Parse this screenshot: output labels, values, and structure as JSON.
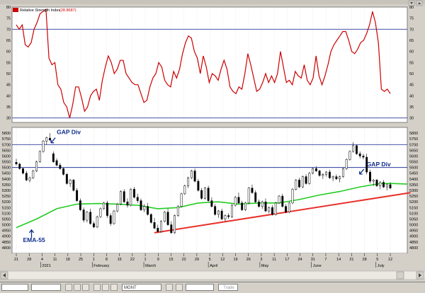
{
  "window": {
    "indicator_title": "Relative Strength Index",
    "indicator_value": "(28.8687)",
    "accent_color": "#cc0000"
  },
  "statusbar": {
    "symbol_field": "MGNT",
    "trade_label": "Trade"
  },
  "chart_data": [
    {
      "type": "line",
      "name": "Relative Strength Index",
      "ylim": [
        28,
        80
      ],
      "y_ticks": [
        30,
        35,
        40,
        45,
        50,
        55,
        60,
        65,
        70,
        75,
        80
      ],
      "reference_lines": [
        70,
        30
      ],
      "line_color": "#cc0000",
      "reference_color": "#2b3a9e",
      "x": [
        0,
        1,
        2,
        3,
        4,
        5,
        6,
        7,
        8,
        9,
        10,
        11,
        12,
        13,
        14,
        15,
        16,
        17,
        18,
        19,
        20,
        21,
        22,
        23,
        24,
        25,
        26,
        27,
        28,
        29,
        30,
        31,
        32,
        33,
        34,
        35,
        36,
        37,
        38,
        39,
        40,
        41,
        42,
        43,
        44,
        45,
        46,
        47,
        48,
        49,
        50,
        51,
        52,
        53,
        54,
        55,
        56,
        57,
        58,
        59,
        60,
        61,
        62,
        63,
        64,
        65,
        66,
        67,
        68,
        69,
        70,
        71,
        72,
        73,
        74,
        75,
        76,
        77,
        78,
        79,
        80,
        81,
        82,
        83,
        84,
        85,
        86,
        87,
        88,
        89,
        90,
        91,
        92,
        93,
        94,
        95,
        96,
        97,
        98,
        99,
        100,
        101,
        102,
        103,
        104,
        105,
        106,
        107,
        108,
        109,
        110,
        111,
        112,
        113,
        114,
        115,
        116,
        117,
        118,
        119,
        120,
        121,
        122,
        123,
        124,
        125,
        126
      ],
      "values": [
        72,
        70,
        72,
        63,
        62,
        64,
        70,
        73,
        77,
        78,
        79,
        57,
        54,
        55,
        45,
        43,
        37,
        35,
        30,
        36,
        44,
        44,
        39,
        33,
        35,
        40,
        42,
        43,
        38,
        47,
        53,
        58,
        55,
        50,
        52,
        56,
        56,
        50,
        48,
        46,
        45,
        45,
        41,
        37,
        38,
        44,
        48,
        50,
        55,
        53,
        47,
        45,
        44,
        51,
        48,
        52,
        59,
        64,
        67,
        66,
        60,
        57,
        50,
        58,
        53,
        46,
        50,
        49,
        47,
        52,
        56,
        52,
        44,
        42,
        41,
        44,
        43,
        50,
        59,
        54,
        48,
        42,
        43,
        46,
        50,
        46,
        49,
        46,
        50,
        60,
        53,
        46,
        47,
        45,
        51,
        49,
        48,
        54,
        47,
        45,
        48,
        58,
        49,
        45,
        49,
        54,
        60,
        63,
        65,
        67,
        69,
        69,
        65,
        60,
        59,
        61,
        64,
        65,
        68,
        72,
        78,
        73,
        64,
        43,
        42,
        43,
        41
      ],
      "x_categories": [
        "21",
        "28",
        "4",
        "11",
        "18",
        "25",
        "1",
        "8",
        "15",
        "22",
        "1",
        "9",
        "15",
        "22",
        "29",
        "5",
        "12",
        "19",
        "26",
        "3",
        "11",
        "17",
        "24",
        "31",
        "7",
        "14",
        "21",
        "28",
        "5",
        "12"
      ]
    },
    {
      "type": "candlestick",
      "ylim": [
        4750,
        5850
      ],
      "y_ticks": [
        4800,
        4850,
        4900,
        4950,
        5000,
        5050,
        5100,
        5150,
        5200,
        5250,
        5300,
        5350,
        5400,
        5450,
        5500,
        5550,
        5600,
        5650,
        5700,
        5750,
        5800
      ],
      "reference_lines": [
        5700,
        5500
      ],
      "month_labels": [
        "2021",
        "February",
        "March",
        "April",
        "May",
        "June",
        "July"
      ],
      "x_categories": [
        "21",
        "28",
        "4",
        "11",
        "18",
        "25",
        "1",
        "8",
        "15",
        "22",
        "1",
        "9",
        "15",
        "22",
        "29",
        "5",
        "12",
        "19",
        "26",
        "3",
        "11",
        "17",
        "24",
        "31",
        "7",
        "14",
        "21",
        "28",
        "5",
        "12"
      ],
      "ohlc": [
        [
          5545,
          5575,
          5520,
          5530
        ],
        [
          5530,
          5540,
          5480,
          5490
        ],
        [
          5490,
          5500,
          5440,
          5450
        ],
        [
          5450,
          5470,
          5380,
          5390
        ],
        [
          5390,
          5420,
          5370,
          5410
        ],
        [
          5410,
          5480,
          5400,
          5470
        ],
        [
          5470,
          5560,
          5460,
          5550
        ],
        [
          5550,
          5650,
          5540,
          5640
        ],
        [
          5640,
          5740,
          5630,
          5730
        ],
        [
          5730,
          5770,
          5700,
          5760
        ],
        [
          5755,
          5800,
          5730,
          5740
        ],
        [
          5620,
          5640,
          5540,
          5550
        ],
        [
          5560,
          5580,
          5510,
          5520
        ],
        [
          5520,
          5540,
          5480,
          5490
        ],
        [
          5490,
          5500,
          5430,
          5440
        ],
        [
          5440,
          5450,
          5350,
          5360
        ],
        [
          5360,
          5400,
          5330,
          5390
        ],
        [
          5390,
          5400,
          5290,
          5300
        ],
        [
          5300,
          5320,
          5200,
          5210
        ],
        [
          5210,
          5230,
          5120,
          5130
        ],
        [
          5130,
          5150,
          5020,
          5040
        ],
        [
          5040,
          5120,
          5020,
          5110
        ],
        [
          5110,
          5140,
          5000,
          5010
        ],
        [
          5010,
          5030,
          4970,
          4980
        ],
        [
          4980,
          5080,
          4970,
          5070
        ],
        [
          5070,
          5150,
          5060,
          5140
        ],
        [
          5140,
          5200,
          5130,
          5190
        ],
        [
          5190,
          5210,
          5060,
          5080
        ],
        [
          5080,
          5100,
          4990,
          5010
        ],
        [
          5010,
          5130,
          5000,
          5120
        ],
        [
          5120,
          5190,
          5110,
          5180
        ],
        [
          5180,
          5300,
          5170,
          5290
        ],
        [
          5290,
          5310,
          5190,
          5200
        ],
        [
          5200,
          5230,
          5150,
          5170
        ],
        [
          5170,
          5320,
          5160,
          5310
        ],
        [
          5310,
          5330,
          5230,
          5240
        ],
        [
          5240,
          5270,
          5190,
          5210
        ],
        [
          5210,
          5230,
          5120,
          5130
        ],
        [
          5130,
          5180,
          5110,
          5160
        ],
        [
          5160,
          5190,
          5080,
          5090
        ],
        [
          5090,
          5100,
          5010,
          5020
        ],
        [
          5020,
          5060,
          4960,
          4970
        ],
        [
          4970,
          5000,
          4930,
          4940
        ],
        [
          4940,
          5040,
          4930,
          5030
        ],
        [
          5030,
          5120,
          5020,
          5110
        ],
        [
          5110,
          5140,
          4990,
          5000
        ],
        [
          5000,
          5030,
          4920,
          4930
        ],
        [
          4930,
          5090,
          4920,
          5080
        ],
        [
          5080,
          5170,
          5070,
          5160
        ],
        [
          5160,
          5280,
          5150,
          5270
        ],
        [
          5270,
          5350,
          5260,
          5340
        ],
        [
          5340,
          5420,
          5320,
          5410
        ],
        [
          5410,
          5480,
          5400,
          5470
        ],
        [
          5470,
          5490,
          5370,
          5380
        ],
        [
          5380,
          5400,
          5290,
          5300
        ],
        [
          5300,
          5320,
          5220,
          5230
        ],
        [
          5230,
          5330,
          5220,
          5320
        ],
        [
          5320,
          5340,
          5200,
          5210
        ],
        [
          5210,
          5240,
          5150,
          5160
        ],
        [
          5160,
          5180,
          5080,
          5090
        ],
        [
          5090,
          5130,
          5060,
          5120
        ],
        [
          5120,
          5140,
          5040,
          5050
        ],
        [
          5050,
          5090,
          5030,
          5080
        ],
        [
          5080,
          5100,
          5050,
          5070
        ],
        [
          5070,
          5180,
          5060,
          5170
        ],
        [
          5170,
          5250,
          5160,
          5240
        ],
        [
          5240,
          5280,
          5180,
          5190
        ],
        [
          5190,
          5210,
          5120,
          5130
        ],
        [
          5130,
          5200,
          5120,
          5190
        ],
        [
          5190,
          5330,
          5180,
          5320
        ],
        [
          5320,
          5350,
          5270,
          5280
        ],
        [
          5280,
          5300,
          5190,
          5200
        ],
        [
          5200,
          5220,
          5150,
          5160
        ],
        [
          5160,
          5210,
          5140,
          5200
        ],
        [
          5200,
          5230,
          5110,
          5120
        ],
        [
          5120,
          5160,
          5100,
          5150
        ],
        [
          5150,
          5170,
          5080,
          5090
        ],
        [
          5090,
          5200,
          5080,
          5190
        ],
        [
          5190,
          5260,
          5180,
          5250
        ],
        [
          5250,
          5270,
          5150,
          5160
        ],
        [
          5160,
          5180,
          5100,
          5110
        ],
        [
          5110,
          5200,
          5100,
          5190
        ],
        [
          5190,
          5320,
          5180,
          5310
        ],
        [
          5310,
          5400,
          5300,
          5390
        ],
        [
          5390,
          5410,
          5320,
          5330
        ],
        [
          5330,
          5430,
          5320,
          5420
        ],
        [
          5420,
          5440,
          5350,
          5360
        ],
        [
          5360,
          5460,
          5350,
          5450
        ],
        [
          5450,
          5500,
          5440,
          5490
        ],
        [
          5490,
          5510,
          5460,
          5470
        ],
        [
          5470,
          5480,
          5420,
          5430
        ],
        [
          5430,
          5450,
          5400,
          5440
        ],
        [
          5440,
          5470,
          5420,
          5460
        ],
        [
          5460,
          5480,
          5400,
          5410
        ],
        [
          5410,
          5430,
          5380,
          5420
        ],
        [
          5420,
          5440,
          5390,
          5400
        ],
        [
          5400,
          5430,
          5370,
          5420
        ],
        [
          5420,
          5500,
          5410,
          5490
        ],
        [
          5490,
          5580,
          5480,
          5570
        ],
        [
          5570,
          5650,
          5560,
          5640
        ],
        [
          5640,
          5720,
          5630,
          5690
        ],
        [
          5690,
          5700,
          5610,
          5620
        ],
        [
          5620,
          5640,
          5580,
          5600
        ],
        [
          5600,
          5620,
          5570,
          5590
        ],
        [
          5590,
          5620,
          5440,
          5460
        ],
        [
          5460,
          5480,
          5360,
          5380
        ],
        [
          5380,
          5400,
          5340,
          5390
        ],
        [
          5390,
          5400,
          5330,
          5340
        ],
        [
          5340,
          5380,
          5310,
          5370
        ],
        [
          5370,
          5390,
          5320,
          5330
        ],
        [
          5330,
          5360,
          5300,
          5350
        ],
        [
          5350,
          5370,
          5310,
          5320
        ]
      ],
      "ema": {
        "label": "EMA-55",
        "color": "#22cc22",
        "points": [
          [
            0,
            4975
          ],
          [
            6,
            5050
          ],
          [
            12,
            5140
          ],
          [
            18,
            5180
          ],
          [
            24,
            5185
          ],
          [
            30,
            5180
          ],
          [
            36,
            5170
          ],
          [
            42,
            5140
          ],
          [
            48,
            5150
          ],
          [
            54,
            5190
          ],
          [
            60,
            5200
          ],
          [
            66,
            5180
          ],
          [
            72,
            5190
          ],
          [
            78,
            5190
          ],
          [
            84,
            5220
          ],
          [
            90,
            5260
          ],
          [
            96,
            5290
          ],
          [
            102,
            5330
          ],
          [
            108,
            5360
          ],
          [
            112,
            5360
          ],
          [
            116,
            5355
          ]
        ]
      },
      "trendline": {
        "color": "#e8302a",
        "points": [
          [
            41,
            4930
          ],
          [
            117,
            5280
          ]
        ]
      },
      "annotations": [
        {
          "text": "GAP Div",
          "x": 12,
          "y": 5790,
          "color": "#0f2d8c"
        },
        {
          "text": "GAP Div",
          "x": 104,
          "y": 5510,
          "color": "#0f2d8c"
        },
        {
          "text": "EMA-55",
          "x": 2,
          "y": 4850,
          "color": "#0f2d8c"
        }
      ]
    }
  ]
}
